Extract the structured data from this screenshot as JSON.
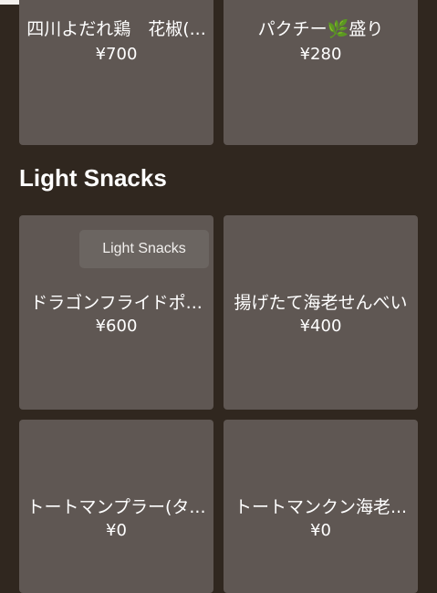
{
  "top_cards": [
    {
      "name": "四川よだれ鶏　花椒(...",
      "price": "¥700"
    },
    {
      "name": "パクチー🌿盛り",
      "price": "¥280"
    }
  ],
  "section": {
    "title": "Light Snacks"
  },
  "tooltip": {
    "text": "Light Snacks"
  },
  "snack_cards": [
    {
      "name": "ドラゴンフライドポ...",
      "price": "¥600"
    },
    {
      "name": "揚げたて海老せんべい",
      "price": "¥400"
    },
    {
      "name": "トートマンプラー(タ...",
      "price": "¥0"
    },
    {
      "name": "トートマンクン海老...",
      "price": "¥0"
    }
  ],
  "colors": {
    "background": "#30271f",
    "card": "#5f5753",
    "tooltip": "#6b6561"
  }
}
